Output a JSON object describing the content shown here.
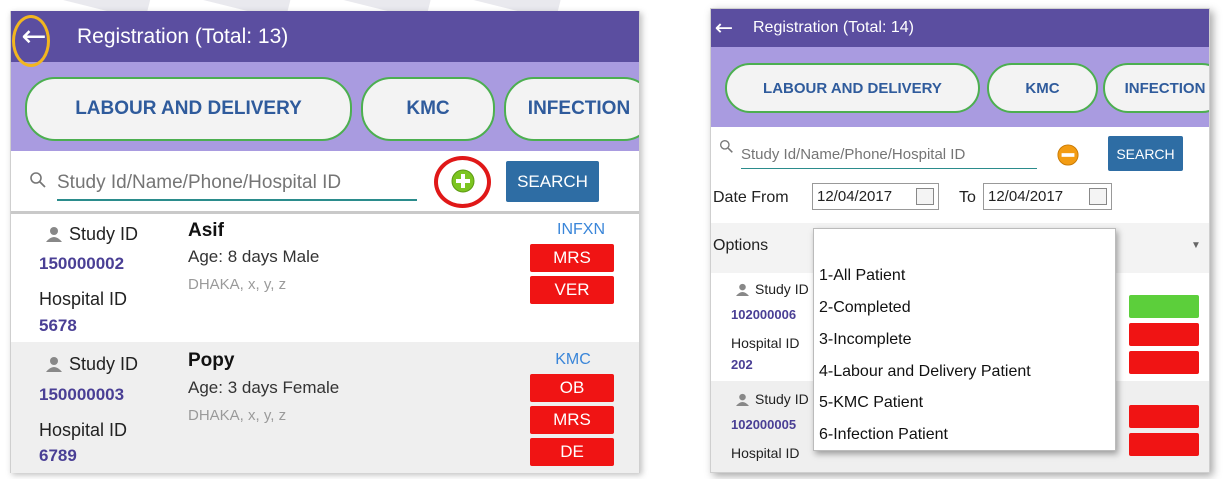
{
  "left": {
    "appbar": {
      "title": "Registration  (Total: 13)"
    },
    "tabs": [
      "LABOUR AND DELIVERY",
      "KMC",
      "INFECTION"
    ],
    "search": {
      "placeholder": "Study Id/Name/Phone/Hospital ID",
      "button_label": "SEARCH"
    },
    "patients": [
      {
        "study_id_label": "Study ID",
        "study_id": "150000002",
        "hospital_id_label": "Hospital ID",
        "hospital_id": "5678",
        "name": "Asif",
        "age": "Age: 8 days  Male",
        "address": "DHAKA, x, y, z",
        "category": "INFXN",
        "badges": [
          "MRS",
          "VER"
        ]
      },
      {
        "study_id_label": "Study ID",
        "study_id": "150000003",
        "hospital_id_label": "Hospital ID",
        "hospital_id": "6789",
        "name": "Popy",
        "age": "Age: 3 days  Female",
        "address": "DHAKA, x, y, z",
        "category": "KMC",
        "badges": [
          "OB",
          "MRS",
          "DE"
        ]
      }
    ]
  },
  "right": {
    "appbar": {
      "title": "Registration  (Total: 14)"
    },
    "tabs": [
      "LABOUR AND DELIVERY",
      "KMC",
      "INFECTION"
    ],
    "search": {
      "placeholder": "Study Id/Name/Phone/Hospital ID",
      "button_label": "SEARCH"
    },
    "date_filter": {
      "from_label": "Date From",
      "from_value": "12/04/2017",
      "to_label": "To",
      "to_value": "12/04/2017"
    },
    "options_label": "Options",
    "options": [
      "1-All Patient",
      "2-Completed",
      "3-Incomplete",
      "4-Labour and Delivery Patient",
      "5-KMC Patient",
      "6-Infection Patient"
    ],
    "patients": [
      {
        "study_id_label": "Study ID",
        "study_id": "102000006",
        "hospital_id_label": "Hospital ID",
        "hospital_id": "202"
      },
      {
        "study_id_label": "Study ID",
        "study_id": "102000005",
        "hospital_id_label": "Hospital ID"
      }
    ]
  },
  "colors": {
    "appbar": "#5b4ea0",
    "tabbar": "#a99be0",
    "tab_border": "#4caf50",
    "badge_red": "#f01414",
    "search_button": "#2e6da4",
    "highlight_orange": "#f2b61f",
    "highlight_red": "#e01818",
    "add_icon": "#7cc520",
    "remove_icon": "#f39c12"
  },
  "icons": [
    "back-arrow-icon",
    "search-icon",
    "add-circle-icon",
    "remove-circle-icon",
    "person-icon",
    "calendar-icon",
    "dropdown-arrow-icon"
  ]
}
